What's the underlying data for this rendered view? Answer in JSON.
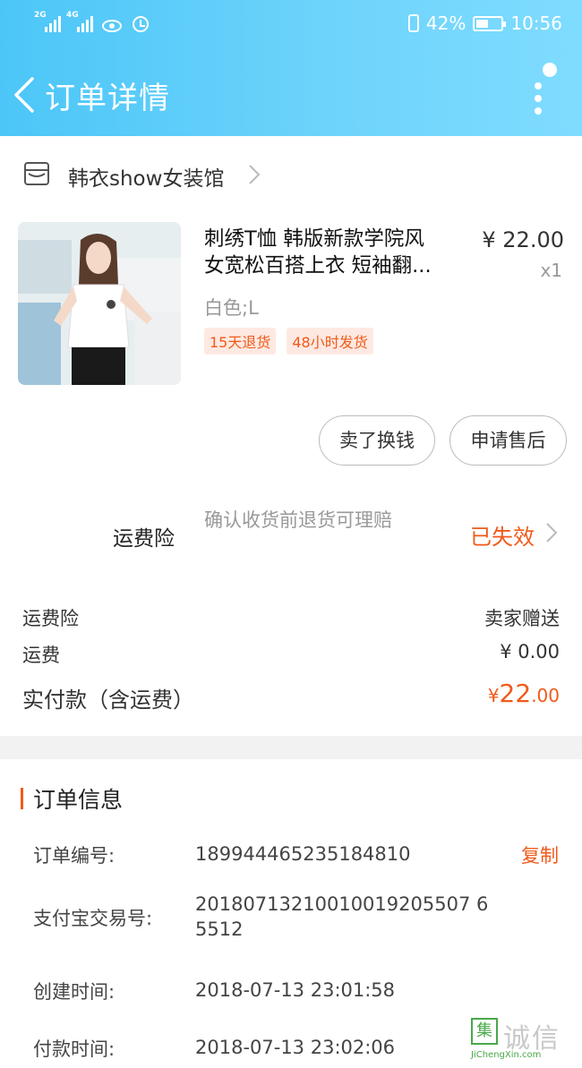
{
  "status_bar": {
    "net1": "2G",
    "net2": "4G",
    "battery": "42%",
    "time": "10:56"
  },
  "nav": {
    "title": "订单详情"
  },
  "shop": {
    "name": "韩衣show女装馆"
  },
  "product": {
    "title_line1": "刺绣T恤 韩版新款学院风",
    "title_line2": "女宽松百搭上衣 短袖翻...",
    "price": "¥ 22.00",
    "qty": "x1",
    "sku": "白色;L",
    "tags": [
      "15天退货",
      "48小时发货"
    ]
  },
  "actions": {
    "sell": "卖了换钱",
    "after_sale": "申请售后"
  },
  "insurance": {
    "label": "运费险",
    "desc": "确认收货前退货可理赔",
    "status": "已失效"
  },
  "fees": [
    {
      "key": "运费险",
      "value": "卖家赠送"
    },
    {
      "key": "运费",
      "value": "¥ 0.00"
    }
  ],
  "paid": {
    "label": "实付款（含运费）",
    "currency": "¥",
    "amount_int": "22",
    "amount_dec": ".00"
  },
  "order_info": {
    "title": "订单信息",
    "copy_label": "复制",
    "rows": [
      {
        "key": "订单编号:",
        "value": "189944465235184810"
      },
      {
        "key": "支付宝交易号:",
        "value": "20180713210010019205507 65512"
      },
      {
        "key": "创建时间:",
        "value": "2018-07-13 23:01:58"
      },
      {
        "key": "付款时间:",
        "value": "2018-07-13 23:02:06"
      }
    ]
  },
  "watermark": {
    "mark": "集",
    "cn": "诚信",
    "en": "JiChengXin.com"
  },
  "colors": {
    "header": "#4cc6f8",
    "accent": "#f05a1a",
    "tag_bg": "#fde9e2"
  }
}
